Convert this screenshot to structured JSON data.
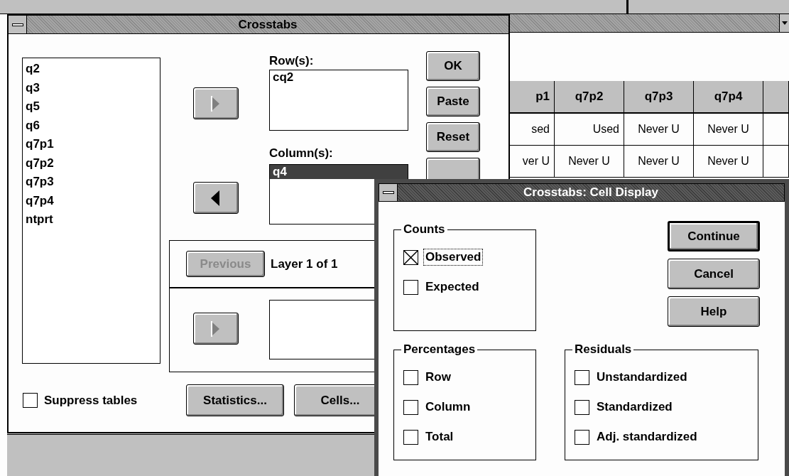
{
  "data_window": {
    "table": {
      "columns": [
        "p1",
        "q7p2",
        "q7p3",
        "q7p4"
      ],
      "rows": [
        [
          "sed",
          "Used",
          "Never U",
          "Never U"
        ],
        [
          "ver U",
          "Never U",
          "Never U",
          "Never U"
        ]
      ]
    }
  },
  "crosstabs": {
    "title": "Crosstabs",
    "variables": [
      "q2",
      "q3",
      "q5",
      "q6",
      "q7p1",
      "q7p2",
      "q7p3",
      "q7p4",
      "ntprt"
    ],
    "arrow_buttons": [
      {
        "kind": "right",
        "disabled": true
      },
      {
        "kind": "left",
        "disabled": false
      },
      {
        "kind": "right",
        "disabled": true
      }
    ],
    "rows_label": "Row(s):",
    "rows_list": [
      "cq2"
    ],
    "columns_label": "Column(s):",
    "columns_list": [
      {
        "label": "q4",
        "selected": true
      }
    ],
    "previous_button": {
      "label": "Previous",
      "disabled": true
    },
    "layer_text": "Layer 1 of 1",
    "suppress_tables": {
      "label": "Suppress tables",
      "checked": false
    },
    "bottom_buttons": [
      "Statistics...",
      "Cells..."
    ],
    "side_buttons": [
      "OK",
      "Paste",
      "Reset"
    ]
  },
  "cell_display": {
    "title": "Crosstabs: Cell Display",
    "buttons": [
      {
        "label": "Continue",
        "default": true
      },
      {
        "label": "Cancel",
        "default": false
      },
      {
        "label": "Help",
        "default": false
      }
    ],
    "groups": [
      {
        "title": "Counts",
        "options": [
          {
            "label": "Observed",
            "checked": true,
            "focused": true
          },
          {
            "label": "Expected",
            "checked": false,
            "focused": false
          }
        ]
      },
      {
        "title": "Percentages",
        "options": [
          {
            "label": "Row",
            "checked": false,
            "focused": false
          },
          {
            "label": "Column",
            "checked": false,
            "focused": false
          },
          {
            "label": "Total",
            "checked": false,
            "focused": false
          }
        ]
      },
      {
        "title": "Residuals",
        "options": [
          {
            "label": "Unstandardized",
            "checked": false,
            "focused": false
          },
          {
            "label": "Standardized",
            "checked": false,
            "focused": false
          },
          {
            "label": "Adj. standardized",
            "checked": false,
            "focused": false
          }
        ]
      }
    ]
  }
}
